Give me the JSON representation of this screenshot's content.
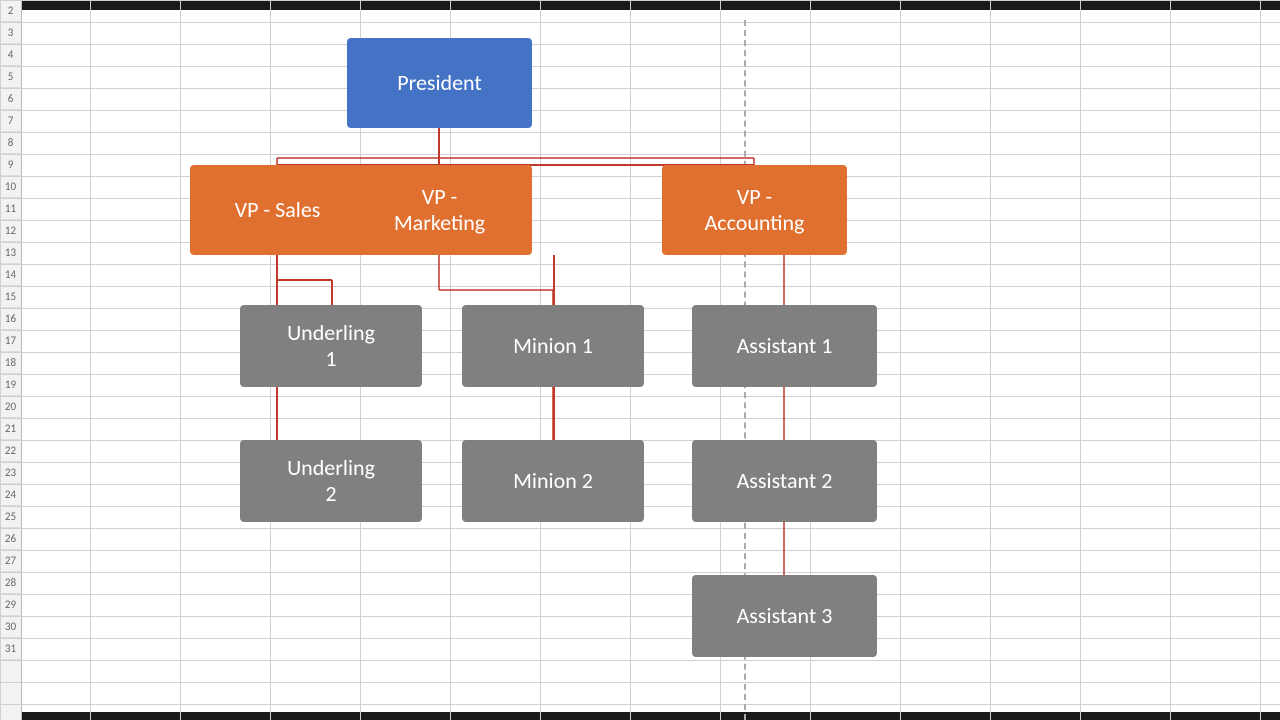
{
  "rows": [
    "2",
    "3",
    "4",
    "5",
    "6",
    "7",
    "8",
    "9",
    "10",
    "11",
    "12",
    "13",
    "14",
    "15",
    "16",
    "17",
    "18",
    "19",
    "20",
    "21",
    "22",
    "23",
    "24",
    "25",
    "26",
    "27",
    "28",
    "29",
    "30"
  ],
  "boxes": {
    "president": "President",
    "vp_sales": "VP - Sales",
    "vp_marketing": "VP -\nMarketing",
    "vp_accounting": "VP -\nAccounting",
    "underling1": "Underling\n1",
    "underling2": "Underling\n2",
    "minion1": "Minion 1",
    "minion2": "Minion 2",
    "assistant1": "Assistant 1",
    "assistant2": "Assistant 2",
    "assistant3": "Assistant 3"
  },
  "colors": {
    "president_bg": "#4472c4",
    "vp_bg": "#e07030",
    "subordinate_bg": "#808080",
    "connector_stroke": "#c0392b",
    "dashed_stroke": "#aaaaaa"
  }
}
